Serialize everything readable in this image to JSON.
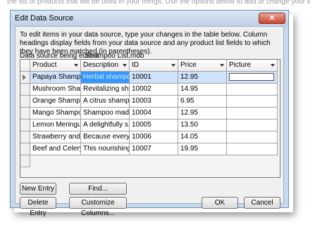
{
  "background_text": "the list of products that will be used in your mergs. Use the options below to add or change your list. Use the",
  "dialog": {
    "title": "Edit Data Source",
    "close_glyph": "✕",
    "instructions": "To edit items in your data source, type your changes in the table below. Column headings display fields from your data source and any product list fields to which they have been matched (in parentheses).",
    "data_source_label": "Data source being edited:",
    "data_source_file": "Shampoo List.mdb"
  },
  "table": {
    "columns": [
      "Product",
      "Description",
      "ID",
      "Price",
      "Picture"
    ],
    "rows": [
      {
        "product": "Papaya Shampoo",
        "description": "Herbal shampo...",
        "id": "10001",
        "price": "12.95",
        "picture": ""
      },
      {
        "product": "Mushroom Sha...",
        "description": "Revitalizing sha...",
        "id": "10002",
        "price": "14.95",
        "picture": ""
      },
      {
        "product": "Orange Shamp...",
        "description": "A citrus shamp...",
        "id": "10003",
        "price": "6.95",
        "picture": ""
      },
      {
        "product": "Mango Shampoo",
        "description": "Shampoo mad...",
        "id": "10004",
        "price": "12.95",
        "picture": ""
      },
      {
        "product": "Lemon Meringue",
        "description": "A delightfully s...",
        "id": "10005",
        "price": "13.50",
        "picture": ""
      },
      {
        "product": "Strawberry and ...",
        "description": "Because every s...",
        "id": "10006",
        "price": "14.05",
        "picture": ""
      },
      {
        "product": "Beef and Celery...",
        "description": "This nourishing...",
        "id": "10007",
        "price": "19.95",
        "picture": ""
      }
    ],
    "selected_row": 0
  },
  "buttons": {
    "new_entry": "New Entry",
    "find": "Find...",
    "delete_entry": "Delete Entry",
    "customize_columns": "Customize Columns...",
    "ok": "OK",
    "cancel": "Cancel"
  },
  "colors": {
    "dialog_frame": "#c9d9ec",
    "selection": "#3399ff",
    "close_button": "#c9442d"
  }
}
